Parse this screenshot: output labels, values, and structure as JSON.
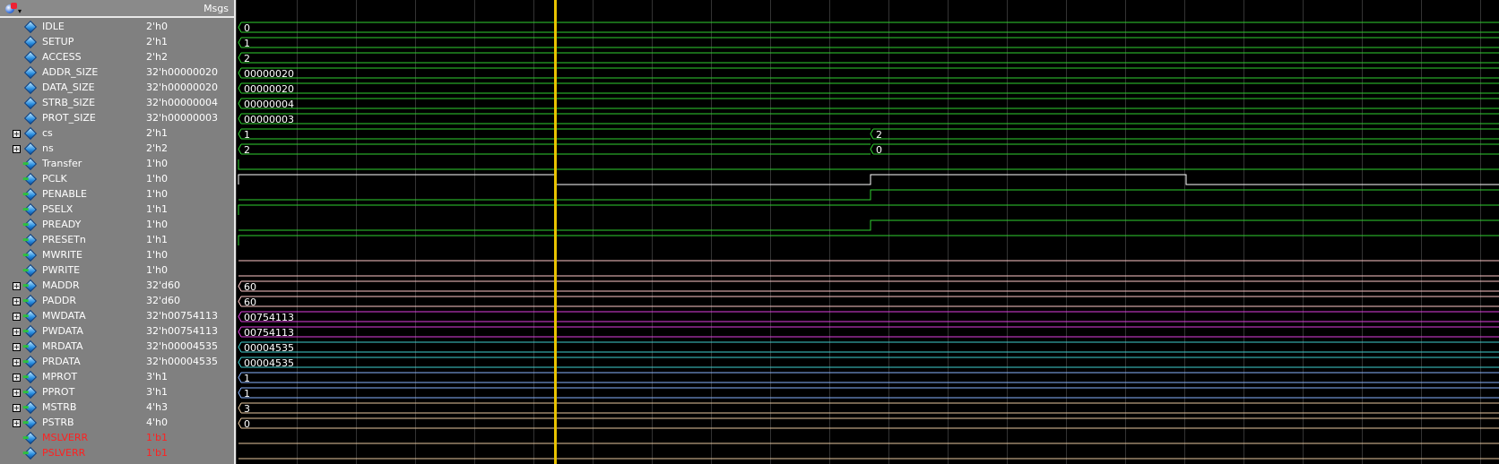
{
  "header": {
    "msgs_label": "Msgs",
    "tool_icon": "wave-tool-icon"
  },
  "signals": [
    {
      "name": "IDLE",
      "value": "2'h0",
      "expand": false,
      "kind": "param",
      "wave": {
        "type": "bus",
        "color": "#2fd02f",
        "label": "0"
      }
    },
    {
      "name": "SETUP",
      "value": "2'h1",
      "expand": false,
      "kind": "param",
      "wave": {
        "type": "bus",
        "color": "#2fd02f",
        "label": "1"
      }
    },
    {
      "name": "ACCESS",
      "value": "2'h2",
      "expand": false,
      "kind": "param",
      "wave": {
        "type": "bus",
        "color": "#2fd02f",
        "label": "2"
      }
    },
    {
      "name": "ADDR_SIZE",
      "value": "32'h00000020",
      "expand": false,
      "kind": "param",
      "wave": {
        "type": "bus",
        "color": "#2fd02f",
        "label": "00000020"
      }
    },
    {
      "name": "DATA_SIZE",
      "value": "32'h00000020",
      "expand": false,
      "kind": "param",
      "wave": {
        "type": "bus",
        "color": "#2fd02f",
        "label": "00000020"
      }
    },
    {
      "name": "STRB_SIZE",
      "value": "32'h00000004",
      "expand": false,
      "kind": "param",
      "wave": {
        "type": "bus",
        "color": "#2fd02f",
        "label": "00000004"
      }
    },
    {
      "name": "PROT_SIZE",
      "value": "32'h00000003",
      "expand": false,
      "kind": "param",
      "wave": {
        "type": "bus",
        "color": "#2fd02f",
        "label": "00000003"
      }
    },
    {
      "name": "cs",
      "value": "2'h1",
      "expand": true,
      "kind": "param",
      "wave": {
        "type": "bus",
        "color": "#2fd02f",
        "label": "1",
        "label2": "2"
      }
    },
    {
      "name": "ns",
      "value": "2'h2",
      "expand": true,
      "kind": "param",
      "wave": {
        "type": "bus",
        "color": "#2fd02f",
        "label": "2",
        "label2": "0"
      }
    },
    {
      "name": "Transfer",
      "value": "1'h0",
      "expand": false,
      "kind": "port",
      "wave": {
        "type": "transfer",
        "color": "#2fd02f"
      }
    },
    {
      "name": "PCLK",
      "value": "1'h0",
      "expand": false,
      "kind": "port",
      "wave": {
        "type": "clk",
        "color": "#ffffff"
      }
    },
    {
      "name": "PENABLE",
      "value": "1'h0",
      "expand": false,
      "kind": "port",
      "wave": {
        "type": "rise",
        "color": "#2fd02f"
      }
    },
    {
      "name": "PSELX",
      "value": "1'h1",
      "expand": false,
      "kind": "port",
      "wave": {
        "type": "high",
        "color": "#2fd02f"
      }
    },
    {
      "name": "PREADY",
      "value": "1'h0",
      "expand": false,
      "kind": "port",
      "wave": {
        "type": "rise",
        "color": "#2fd02f"
      }
    },
    {
      "name": "PRESETn",
      "value": "1'h1",
      "expand": false,
      "kind": "port",
      "wave": {
        "type": "high",
        "color": "#2fd02f"
      }
    },
    {
      "name": "MWRITE",
      "value": "1'h0",
      "expand": false,
      "kind": "port",
      "wave": {
        "type": "low",
        "color": "#ffc8c8"
      }
    },
    {
      "name": "PWRITE",
      "value": "1'h0",
      "expand": false,
      "kind": "port",
      "wave": {
        "type": "low",
        "color": "#ffc8c8"
      }
    },
    {
      "name": "MADDR",
      "value": "32'd60",
      "expand": true,
      "kind": "port",
      "wave": {
        "type": "bus",
        "color": "#ffc8c8",
        "label": "60"
      }
    },
    {
      "name": "PADDR",
      "value": "32'd60",
      "expand": true,
      "kind": "port",
      "wave": {
        "type": "bus",
        "color": "#ffc8c8",
        "label": "60"
      }
    },
    {
      "name": "MWDATA",
      "value": "32'h00754113",
      "expand": true,
      "kind": "port",
      "wave": {
        "type": "bus",
        "color": "#e040e0",
        "label": "00754113"
      }
    },
    {
      "name": "PWDATA",
      "value": "32'h00754113",
      "expand": true,
      "kind": "port",
      "wave": {
        "type": "bus",
        "color": "#e040e0",
        "label": "00754113"
      }
    },
    {
      "name": "MRDATA",
      "value": "32'h00004535",
      "expand": true,
      "kind": "port",
      "wave": {
        "type": "bus",
        "color": "#40d0d0",
        "label": "00004535"
      }
    },
    {
      "name": "PRDATA",
      "value": "32'h00004535",
      "expand": true,
      "kind": "port",
      "wave": {
        "type": "bus",
        "color": "#40d0d0",
        "label": "00004535"
      }
    },
    {
      "name": "MPROT",
      "value": "3'h1",
      "expand": true,
      "kind": "port",
      "wave": {
        "type": "bus",
        "color": "#8ab4ff",
        "label": "1"
      }
    },
    {
      "name": "PPROT",
      "value": "3'h1",
      "expand": true,
      "kind": "port",
      "wave": {
        "type": "bus",
        "color": "#8ab4ff",
        "label": "1"
      }
    },
    {
      "name": "MSTRB",
      "value": "4'h3",
      "expand": true,
      "kind": "port",
      "wave": {
        "type": "bus",
        "color": "#e8c8a0",
        "label": "3"
      }
    },
    {
      "name": "PSTRB",
      "value": "4'h0",
      "expand": true,
      "kind": "port",
      "wave": {
        "type": "bus",
        "color": "#e8c8a0",
        "label": "0"
      }
    },
    {
      "name": "MSLVERR",
      "value": "1'b1",
      "expand": false,
      "kind": "port",
      "red": true,
      "wave": {
        "type": "low",
        "color": "#e8c8a0"
      }
    },
    {
      "name": "PSLVERR",
      "value": "1'b1",
      "expand": false,
      "kind": "port",
      "red": true,
      "wave": {
        "type": "low",
        "color": "#e8c8a0"
      }
    }
  ]
}
